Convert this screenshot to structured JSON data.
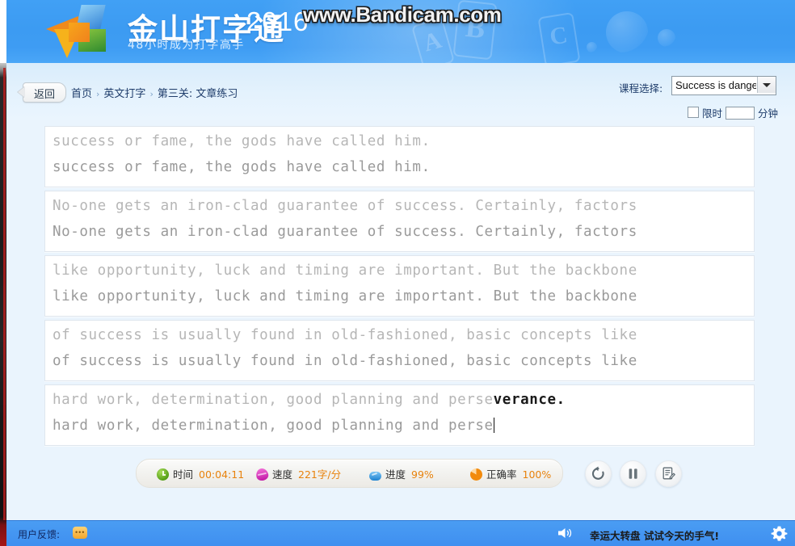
{
  "header": {
    "brand_zh": "金山打字通",
    "brand_year": "2016",
    "slogan": "48小时成为打字高手",
    "watermark": "www.Bandicam.com",
    "deco_letters": [
      "A",
      "B",
      "C"
    ]
  },
  "nav": {
    "back_label": "返回",
    "breadcrumb": [
      {
        "label": "首页"
      },
      {
        "label": "英文打字"
      },
      {
        "label": "第三关: 文章练习"
      }
    ],
    "separator": "›",
    "course_label": "课程选择:",
    "course_value": "Success is dangero",
    "limit_label": "限时",
    "limit_minutes_value": "",
    "minutes_unit": "分钟",
    "limit_checked": false
  },
  "typing": {
    "lines": [
      {
        "reference": "success or fame, the gods have called him.",
        "typed": "success or fame, the gods have called him.",
        "pending": "",
        "active": false
      },
      {
        "reference": "No-one gets an iron-clad guarantee of success. Certainly, factors",
        "typed": "No-one gets an iron-clad guarantee of success. Certainly, factors",
        "pending": "",
        "active": false
      },
      {
        "reference": "like opportunity, luck and timing are important. But the backbone",
        "typed": "like opportunity, luck and timing are important. But the backbone",
        "pending": "",
        "active": false
      },
      {
        "reference": "of success is usually found in old-fashioned, basic concepts like",
        "typed": "of success is usually found in old-fashioned, basic concepts like",
        "pending": "",
        "active": false
      },
      {
        "reference": "hard work, determination, good planning and perse",
        "typed": "hard work, determination, good planning and perse",
        "pending": "verance.",
        "active": true
      }
    ]
  },
  "status": {
    "time_label": "时间",
    "time_value": "00:04:11",
    "speed_label": "速度",
    "speed_value": "221字/分",
    "progress_label": "进度",
    "progress_value": "99%",
    "accuracy_label": "正确率",
    "accuracy_value": "100%"
  },
  "controls": {
    "restart_title": "重新开始",
    "pause_title": "暂停",
    "report_title": "测试成绩"
  },
  "bottom": {
    "feedback_label": "用户反馈:",
    "promo_text": "幸运大转盘 试试今天的手气!"
  },
  "colors": {
    "header_blue": "#3c9bf2",
    "page_blue": "#eaf4fd",
    "accent_orange": "#e8820c",
    "breadcrumb_navy": "#1f3d6b",
    "ref_gray": "#b6b6b6",
    "typed_gray": "#9a9a9a",
    "pending_dark": "#1a1a1a"
  }
}
